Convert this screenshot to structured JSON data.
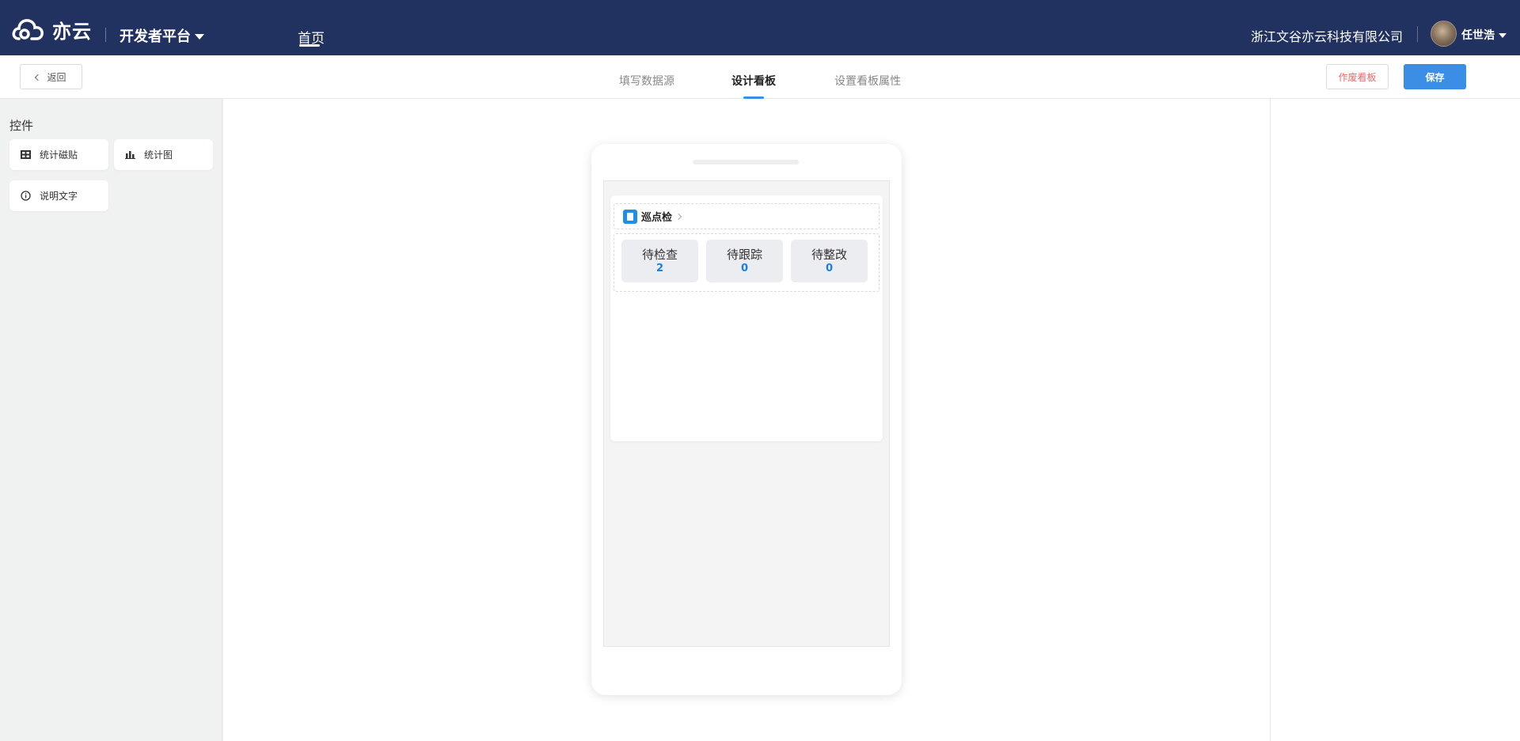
{
  "topbar": {
    "brand": "亦云",
    "platform": "开发者平台",
    "home": "首页",
    "company": "浙江文谷亦云科技有限公司",
    "username": "任世浩"
  },
  "toolbar": {
    "back_label": "返回",
    "tabs": [
      {
        "label": "填写数据源",
        "active": false
      },
      {
        "label": "设计看板",
        "active": true
      },
      {
        "label": "设置看板属性",
        "active": false
      }
    ],
    "void_label": "作废看板",
    "save_label": "保存"
  },
  "controls": {
    "title": "控件",
    "items": [
      {
        "label": "统计磁贴",
        "icon": "tiles-icon"
      },
      {
        "label": "统计图",
        "icon": "bar-chart-icon"
      },
      {
        "label": "说明文字",
        "icon": "info-icon"
      }
    ]
  },
  "preview": {
    "card_title": "巡点检",
    "tiles": [
      {
        "label": "待检查",
        "value": "2"
      },
      {
        "label": "待跟踪",
        "value": "0"
      },
      {
        "label": "待整改",
        "value": "0"
      }
    ]
  },
  "colors": {
    "navbar": "#223260",
    "accent": "#3a8ee6",
    "danger": "#e56a6a",
    "tile_value": "#1b7fe0"
  }
}
